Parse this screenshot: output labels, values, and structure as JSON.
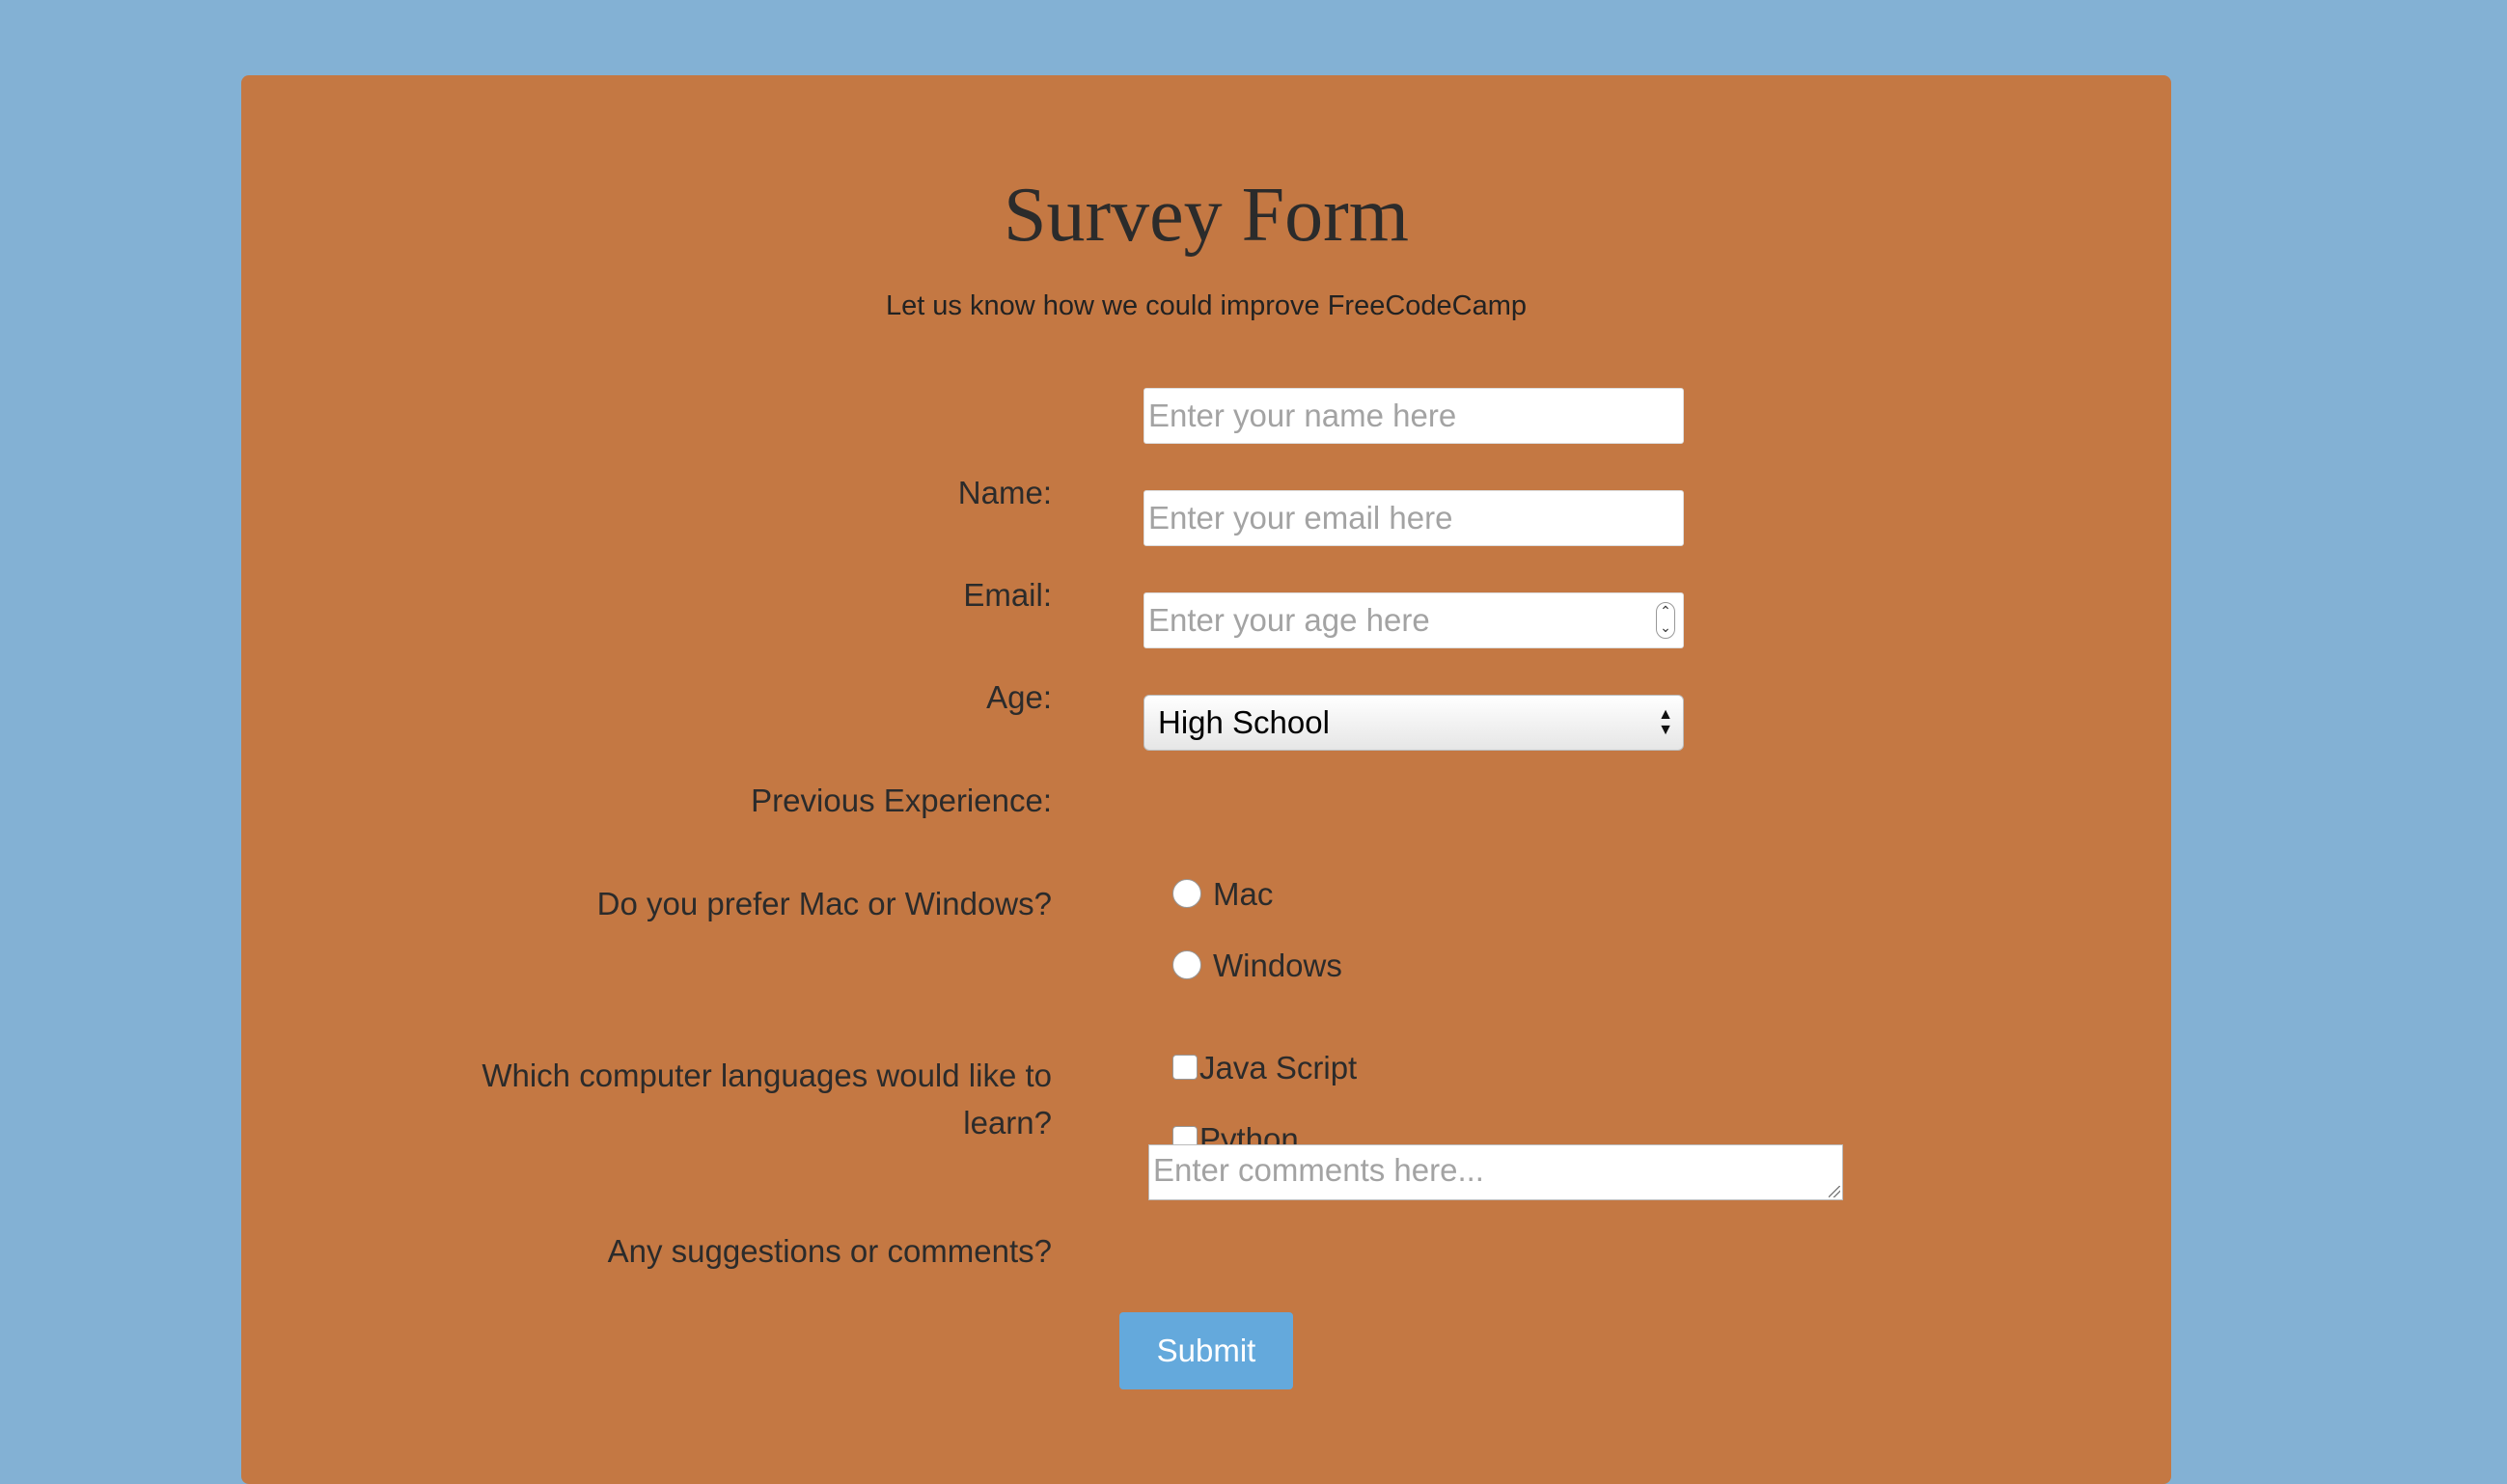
{
  "form": {
    "title": "Survey Form",
    "description": "Let us know how we could improve FreeCodeCamp",
    "name": {
      "label": "Name:",
      "placeholder": "Enter your name here"
    },
    "email": {
      "label": "Email:",
      "placeholder": "Enter your email here"
    },
    "age": {
      "label": "Age:",
      "placeholder": "Enter your age here"
    },
    "experience": {
      "label": "Previous Experience:",
      "selected": "High School"
    },
    "platform": {
      "label": "Do you prefer Mac or Windows?",
      "options": [
        "Mac",
        "Windows"
      ]
    },
    "languages": {
      "label": "Which computer languages would like to learn?",
      "options": [
        "Java Script",
        "Python"
      ]
    },
    "comments": {
      "label": "Any suggestions or comments?",
      "placeholder": "Enter comments here..."
    },
    "submit_label": "Submit"
  },
  "colors": {
    "page_background": "#83b1d4",
    "card_background": "#c47843",
    "submit_button": "#64a9dc"
  }
}
